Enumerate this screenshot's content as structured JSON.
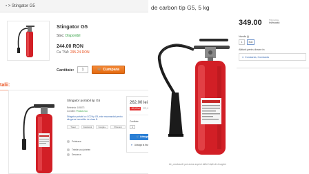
{
  "left_panel": {
    "breadcrumb": {
      "home": "▪",
      "current": "Stingator G5"
    },
    "product_title": "Stingator G5",
    "stock_label": "Stoc:",
    "stock_value": "Disponibil",
    "price": "244.00 RON",
    "price_vat_label": "Cu TVA:",
    "price_vat_value": "295.24 RON",
    "quantity_label": "Cantitate:",
    "quantity_value": "1",
    "buy_button": "Cumpara",
    "details_heading": "talii:"
  },
  "middle_panel": {
    "product_title": "Stingator portabil tip G5",
    "meta_code": "Referinta: 105573",
    "meta_stock_label": "Conditie:",
    "meta_stock_value": "Produs nou",
    "description": "Stingator portabil cu CO2 tip G5, este recomandat pentru stingerea incendiilor de clasa B.",
    "share_buttons": [
      "Tweet",
      "Facebook",
      "Google+",
      "Pinterest"
    ],
    "link_print": "Printeaza",
    "link_send": "Trimite unui prieten",
    "link_download": "Descarca",
    "price": "262,00 lei",
    "price_unit": "fara TVA",
    "discount_badge": "-10,00 lei",
    "old_price": "272,00 lei",
    "quantity_label": "Cantitate",
    "quantity_value": "1",
    "add_to_cart": "Adauga in cos",
    "favorites": "Adauga la favorite"
  },
  "right_panel": {
    "title": "de carbon tip G5, 5 kg",
    "price": "349.00",
    "price_side_line1": "TVA inclus",
    "price_side_line2": "lei/bucată",
    "red_note": "",
    "quantity_label": "Număr (l)",
    "quantity_value": "1",
    "quantity_unit": "buc",
    "delivery_label": "Alătură pentru livrare în:",
    "location": "Constanta, Constanta",
    "caption": "ile, produsele pot avea aspect diferit față de imagine"
  },
  "colors": {
    "accent_orange": "#e94f1d",
    "buy_button": "#e36a10",
    "cart_button": "#2b7fd5",
    "in_stock": "#2e9e3e",
    "extinguisher_red": "#d21f26"
  }
}
